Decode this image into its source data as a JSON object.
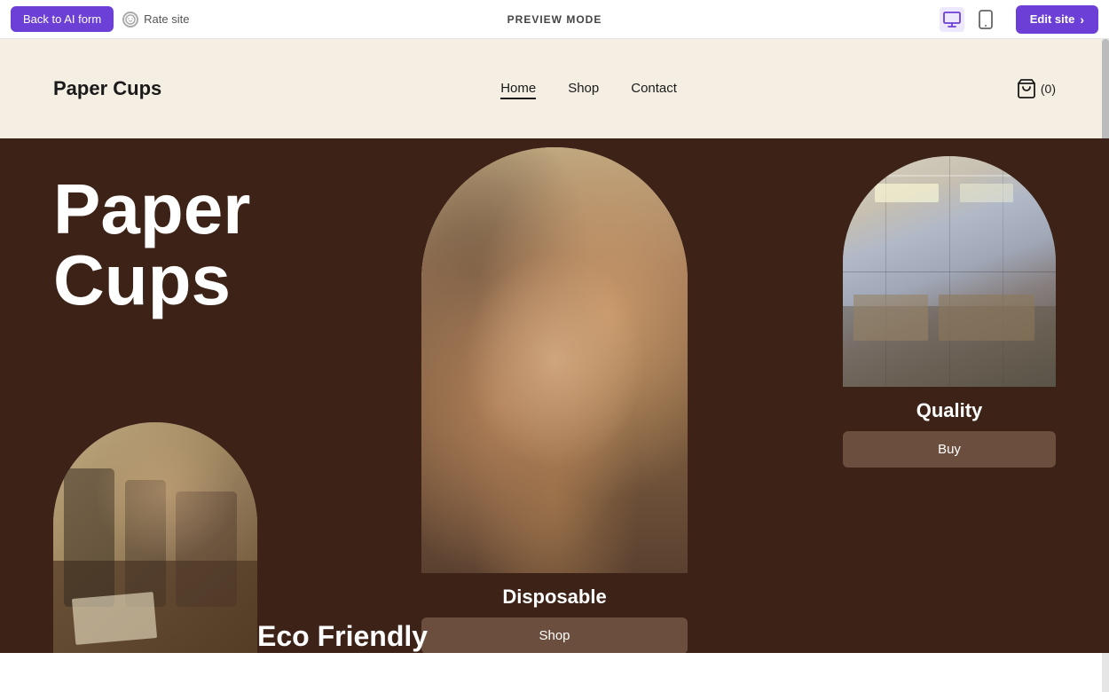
{
  "toolbar": {
    "back_button": "Back to AI form",
    "rate_site": "Rate site",
    "preview_mode": "PREVIEW MODE",
    "edit_site": "Edit site"
  },
  "site": {
    "logo": "Paper Cups",
    "nav": [
      {
        "label": "Home",
        "active": true
      },
      {
        "label": "Shop",
        "active": false
      },
      {
        "label": "Contact",
        "active": false
      }
    ],
    "cart": "(0)"
  },
  "hero": {
    "title_line1": "Paper",
    "title_line2": "Cups"
  },
  "cards": [
    {
      "id": "center",
      "label": "Disposable",
      "button": "Shop"
    },
    {
      "id": "right",
      "label": "Quality",
      "button": "Buy"
    },
    {
      "id": "left",
      "label": "Eco Friendly",
      "button": ""
    }
  ]
}
